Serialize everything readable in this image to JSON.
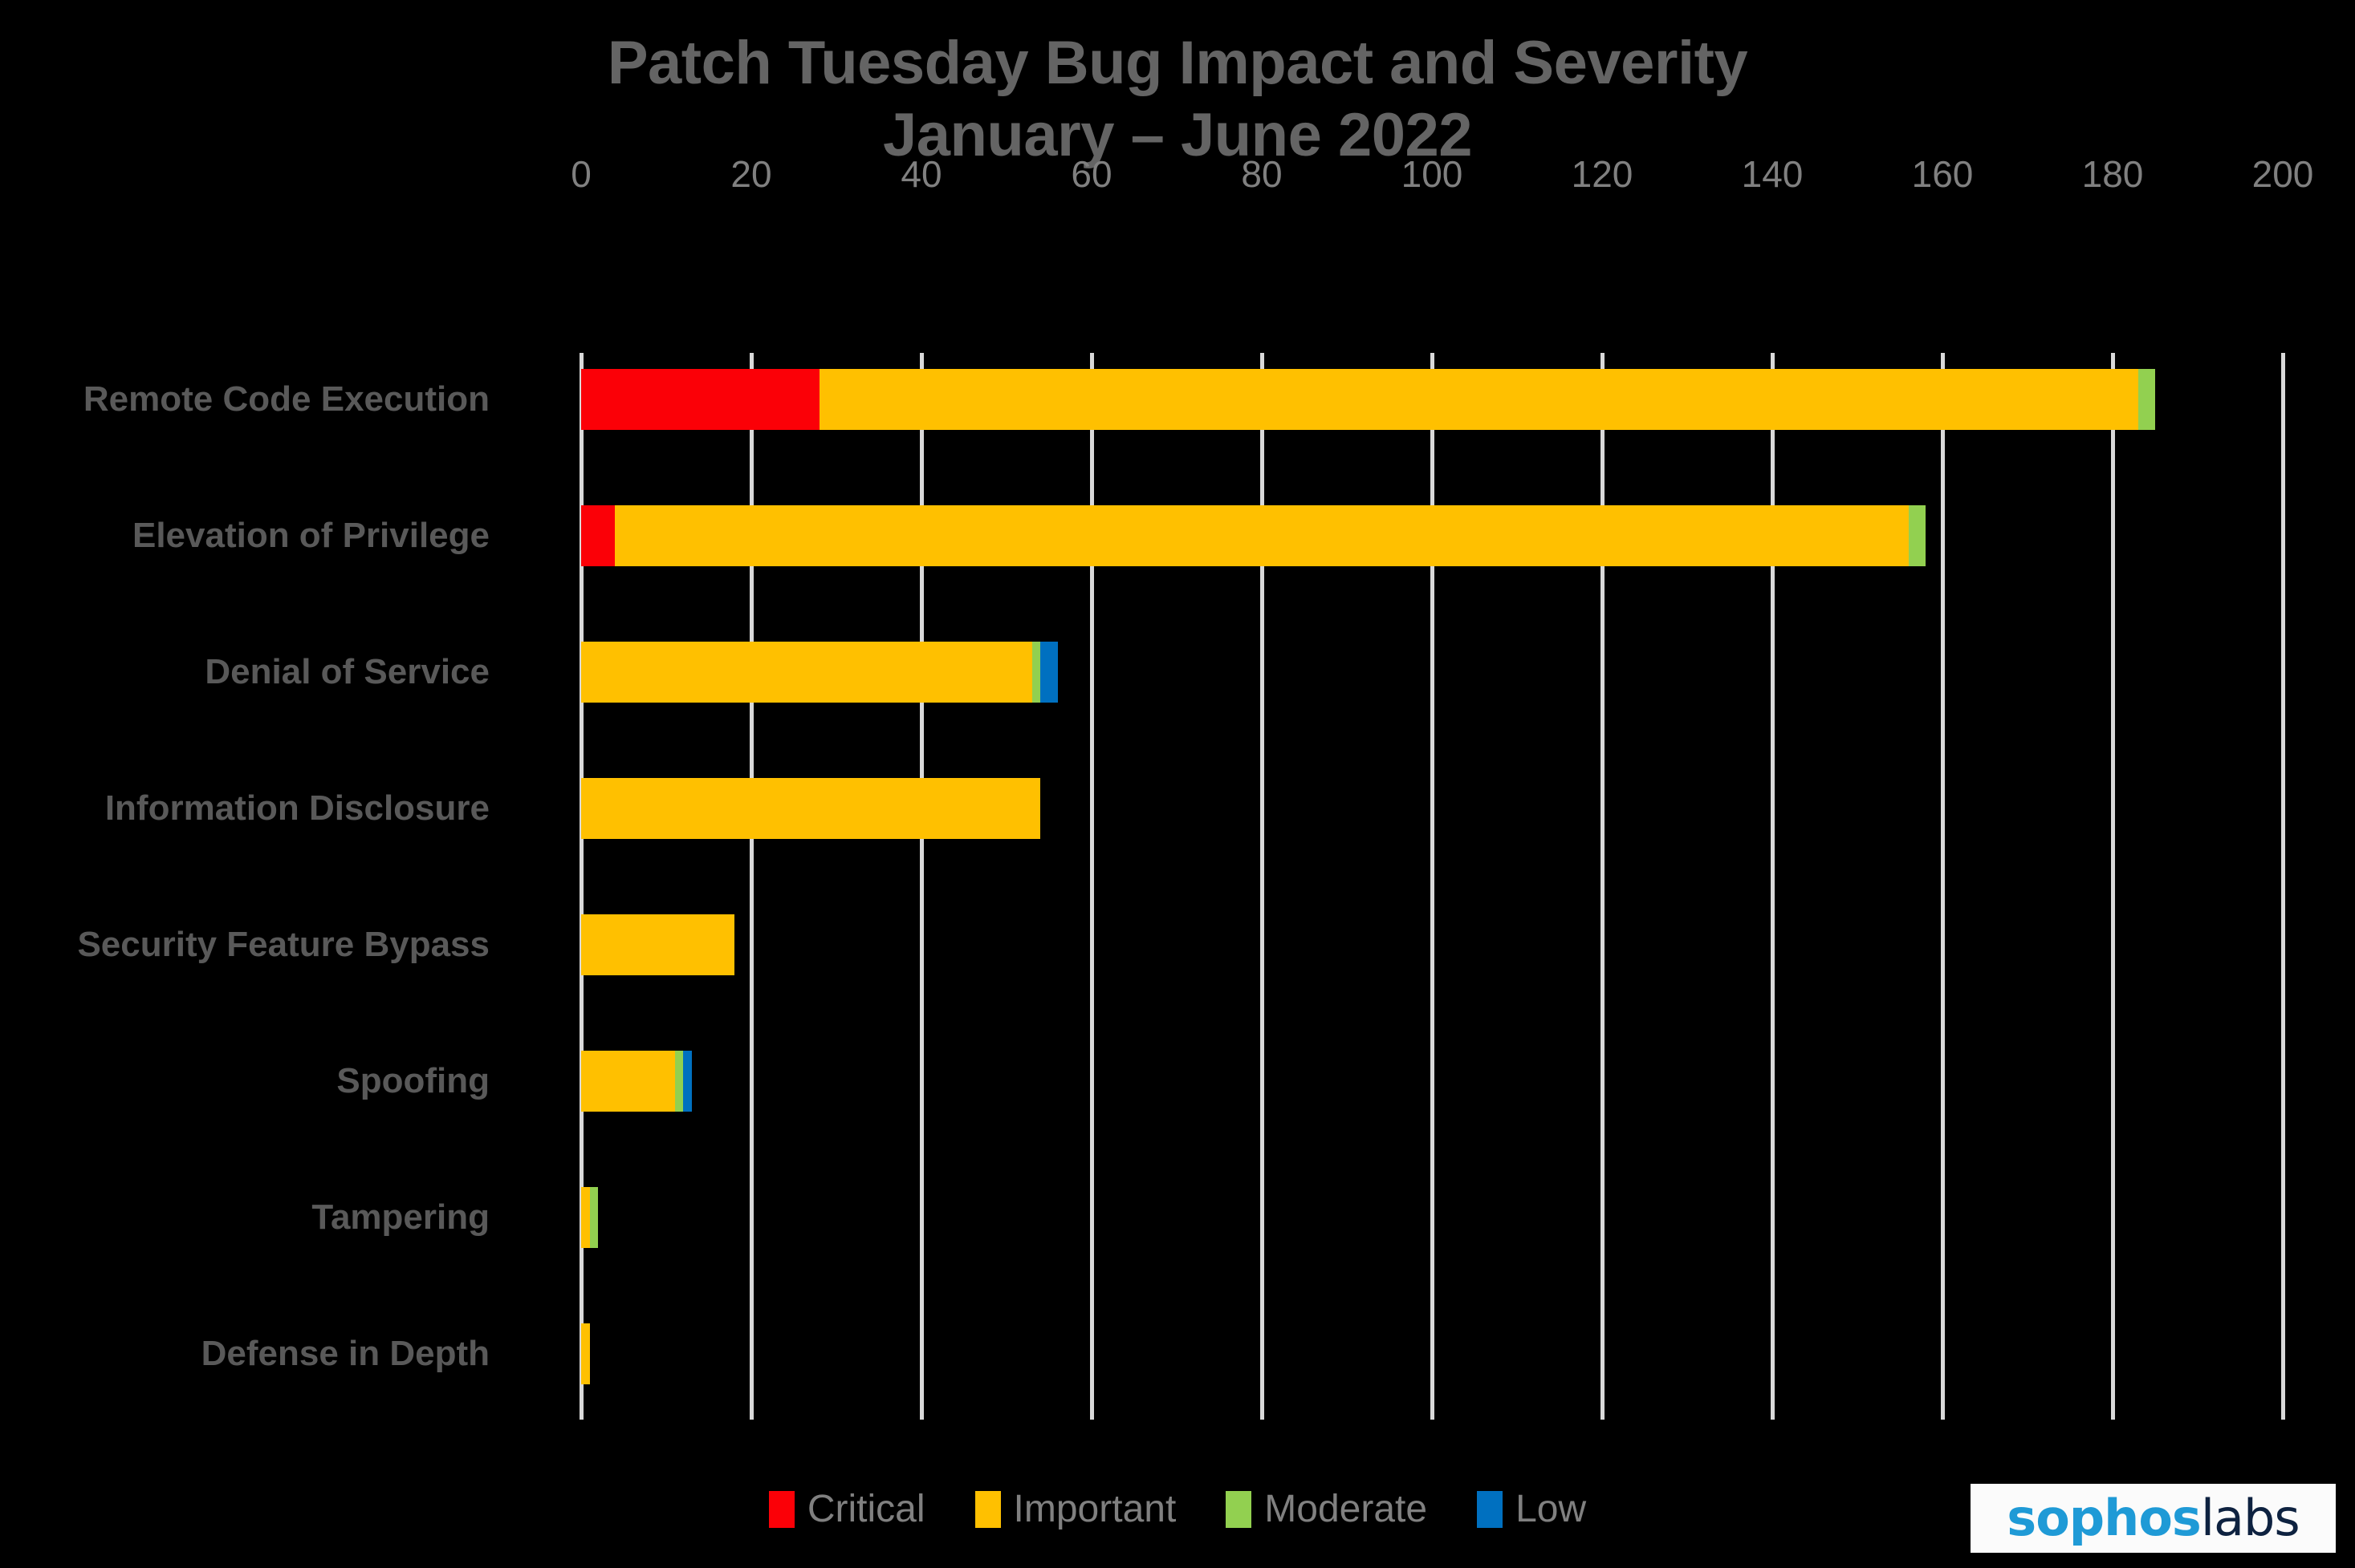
{
  "chart_data": {
    "type": "bar",
    "orientation": "horizontal",
    "stacked": true,
    "title": "Patch Tuesday Bug Impact and Severity\nJanuary – June 2022",
    "title_line1": "Patch Tuesday Bug Impact and Severity",
    "title_line2": "January – June 2022",
    "xlabel": "",
    "ylabel": "",
    "xlim": [
      0,
      200
    ],
    "xticks": [
      0,
      20,
      40,
      60,
      80,
      100,
      120,
      140,
      160,
      180,
      200
    ],
    "xtick_labels": [
      "0",
      "20",
      "40",
      "60",
      "80",
      "100",
      "120",
      "140",
      "160",
      "180",
      "200"
    ],
    "grid": "vertical",
    "legend_position": "bottom-center",
    "background_color": "#000000",
    "gridline_color": "#d9d9d9",
    "text_color": "#808080",
    "label_color": "#595959",
    "categories": [
      "Remote Code Execution",
      "Elevation of Privilege",
      "Denial of Service",
      "Information Disclosure",
      "Security Feature Bypass",
      "Spoofing",
      "Tampering",
      "Defense in Depth"
    ],
    "series": [
      {
        "name": "Critical",
        "color": "#fb0007",
        "values": [
          28,
          4,
          0,
          0,
          0,
          0,
          0,
          0
        ]
      },
      {
        "name": "Important",
        "color": "#ffc000",
        "values": [
          155,
          152,
          53,
          54,
          18,
          11,
          1,
          1
        ]
      },
      {
        "name": "Moderate",
        "color": "#92d050",
        "values": [
          2,
          2,
          1,
          0,
          0,
          1,
          1,
          0
        ]
      },
      {
        "name": "Low",
        "color": "#0070c0",
        "values": [
          0,
          0,
          2,
          0,
          0,
          1,
          0,
          0
        ]
      }
    ],
    "legend": [
      {
        "label": "Critical",
        "color": "#fb0007"
      },
      {
        "label": "Important",
        "color": "#ffc000"
      },
      {
        "label": "Moderate",
        "color": "#92d050"
      },
      {
        "label": "Low",
        "color": "#0070c0"
      }
    ]
  },
  "logo": {
    "part1": "sophos",
    "part2": "labs",
    "part1_color": "#1f9ad6",
    "part2_color": "#0e2240"
  }
}
